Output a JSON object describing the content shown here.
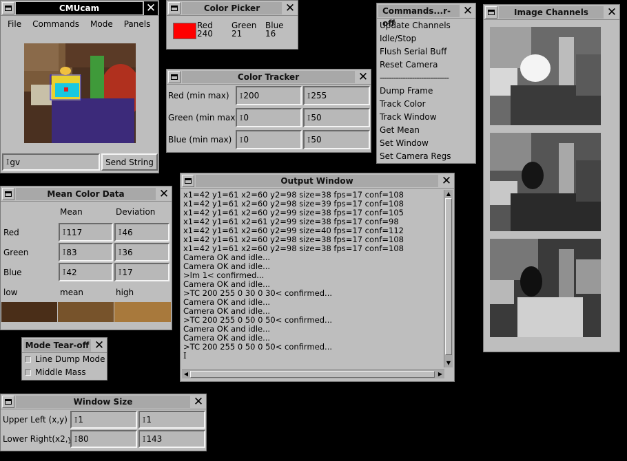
{
  "cmucam": {
    "title": "CMUcam",
    "menu": [
      "File",
      "Commands",
      "Mode",
      "Panels"
    ],
    "string_input": "gv",
    "send_button": "Send String"
  },
  "color_picker": {
    "title": "Color Picker",
    "swatch_color": "#ff0000",
    "red_label": "Red",
    "red_value": "240",
    "green_label": "Green",
    "green_value": "21",
    "blue_label": "Blue",
    "blue_value": "16"
  },
  "color_tracker": {
    "title": "Color Tracker",
    "rows": [
      {
        "label": "Red (min max)",
        "min": "200",
        "max": "255"
      },
      {
        "label": "Green (min max)",
        "min": "0",
        "max": "50"
      },
      {
        "label": "Blue (min max)",
        "min": "0",
        "max": "50"
      }
    ]
  },
  "commands": {
    "title": "Commands...r-off",
    "items_top": [
      "Update Channels",
      "Idle/Stop",
      "Flush Serial Buff",
      "Reset Camera"
    ],
    "separator": "------------------------------",
    "items_bottom": [
      "Dump Frame",
      "Track Color",
      "Track Window",
      "Get Mean",
      "Set Window",
      "Set Camera Regs"
    ]
  },
  "image_channels": {
    "title": "Image Channels"
  },
  "mean_color": {
    "title": "Mean Color Data",
    "col_mean": "Mean",
    "col_dev": "Deviation",
    "rows": [
      {
        "label": "Red",
        "mean": "117",
        "dev": "46"
      },
      {
        "label": "Green",
        "mean": "83",
        "dev": "36"
      },
      {
        "label": "Blue",
        "mean": "42",
        "dev": "17"
      }
    ],
    "low_label": "low",
    "mean_label": "mean",
    "high_label": "high",
    "swatches": [
      "#4a2e18",
      "#77532b",
      "#a8793c"
    ]
  },
  "output": {
    "title": "Output Window",
    "lines": [
      "x1=42 y1=61 x2=60 y2=98 size=38 fps=17 conf=108",
      "x1=42 y1=61 x2=60 y2=98 size=39 fps=17 conf=108",
      "x1=42 y1=61 x2=60 y2=99 size=38 fps=17 conf=105",
      "x1=42 y1=61 x2=61 y2=99 size=38 fps=17 conf=98",
      "x1=42 y1=61 x2=60 y2=99 size=40 fps=17 conf=112",
      "x1=42 y1=61 x2=60 y2=98 size=38 fps=17 conf=108",
      "x1=42 y1=61 x2=60 y2=98 size=38 fps=17 conf=108",
      "Camera OK and idle...",
      "Camera OK and idle...",
      ">lm 1< confirmed...",
      "Camera OK and idle...",
      ">TC 200 255 0 30 0 30< confirmed...",
      "Camera OK and idle...",
      "Camera OK and idle...",
      ">TC 200 255 0 50 0 50< confirmed...",
      "Camera OK and idle...",
      "Camera OK and idle...",
      ">TC 200 255 0 50 0 50< confirmed..."
    ]
  },
  "mode_tearoff": {
    "title": "Mode Tear-off",
    "items": [
      "Line Dump Mode",
      "Middle Mass"
    ]
  },
  "window_size": {
    "title": "Window Size",
    "rows": [
      {
        "label": "Upper Left (x,y)",
        "a": "1",
        "b": "1"
      },
      {
        "label": "Lower Right(x2,y",
        "a": "80",
        "b": "143"
      }
    ]
  }
}
